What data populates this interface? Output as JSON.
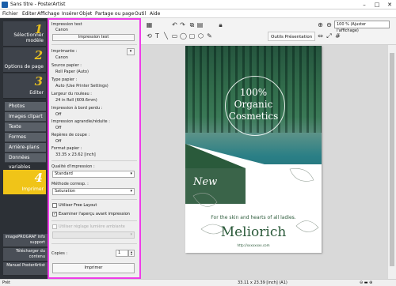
{
  "window": {
    "title": "Sans titre - PosterArtist"
  },
  "menu": [
    "Fichier",
    "Editer",
    "Affichage",
    "Insérer",
    "Objet",
    "Partage ou page",
    "Outil",
    "Aide"
  ],
  "toolbar": {
    "presentation_tools": "Outils Présentation",
    "zoom": "100 % (Ajuster l'affichage)"
  },
  "nav": {
    "steps": [
      {
        "num": "1",
        "label": "Sélectionner modèle"
      },
      {
        "num": "2",
        "label": "Options de page"
      },
      {
        "num": "3",
        "label": "Editer"
      },
      {
        "num": "4",
        "label": "Imprimer"
      }
    ],
    "items": [
      "Photos",
      "Images clipart",
      "Texte",
      "Formes",
      "Arrière-plans",
      "Données variables"
    ],
    "bottom": [
      "imagePROGRAF info support",
      "Télécharger du contenu",
      "Manuel PosterArtist"
    ]
  },
  "print": {
    "test_label": "Impression test",
    "test_printer": "Canon",
    "test_button": "Impression test",
    "printer_label": "Imprimante :",
    "printer_value": "Canon",
    "source_label": "Source papier :",
    "source_value": "Roll Paper (Auto)",
    "type_label": "Type papier :",
    "type_value": "Auto (Use Printer Settings)",
    "width_label": "Largeur du rouleau :",
    "width_value": "24 in Roll (609.6mm)",
    "borderless_label": "Impression à bord perdu :",
    "borderless_value": "Off",
    "enlarge_label": "Impression agrandie/réduite :",
    "enlarge_value": "Off",
    "cutmarks_label": "Repères de coupe :",
    "cutmarks_value": "Off",
    "format_label": "Format papier :",
    "format_value": "33.35 x 23.62 [inch]",
    "quality_label": "Qualité d'impression :",
    "quality_value": "Standard",
    "method_label": "Méthode corresp. :",
    "method_value": "Saturation",
    "free_layout": "Utiliser Free Layout",
    "preview": "Examiner l'aperçu avant impression",
    "ambient": "Utiliser réglage lumière ambiante",
    "copies_label": "Copies :",
    "copies_value": "1",
    "print_button": "Imprimer"
  },
  "poster": {
    "headline_1": "100%",
    "headline_2": "Organic",
    "headline_3": "Cosmetics",
    "badge": "New",
    "tagline": "For the skin and hearts of all ladies.",
    "brand": "Meliorich",
    "url": "http://xxxxxxxx.com"
  },
  "status": {
    "left": "Prêt",
    "size": "33.11 x 23.39 [inch] (A1)"
  },
  "colors": {
    "panel_border": "#ee3ce8",
    "active_step": "#f0c418",
    "brand_green": "#2b5a3a"
  }
}
